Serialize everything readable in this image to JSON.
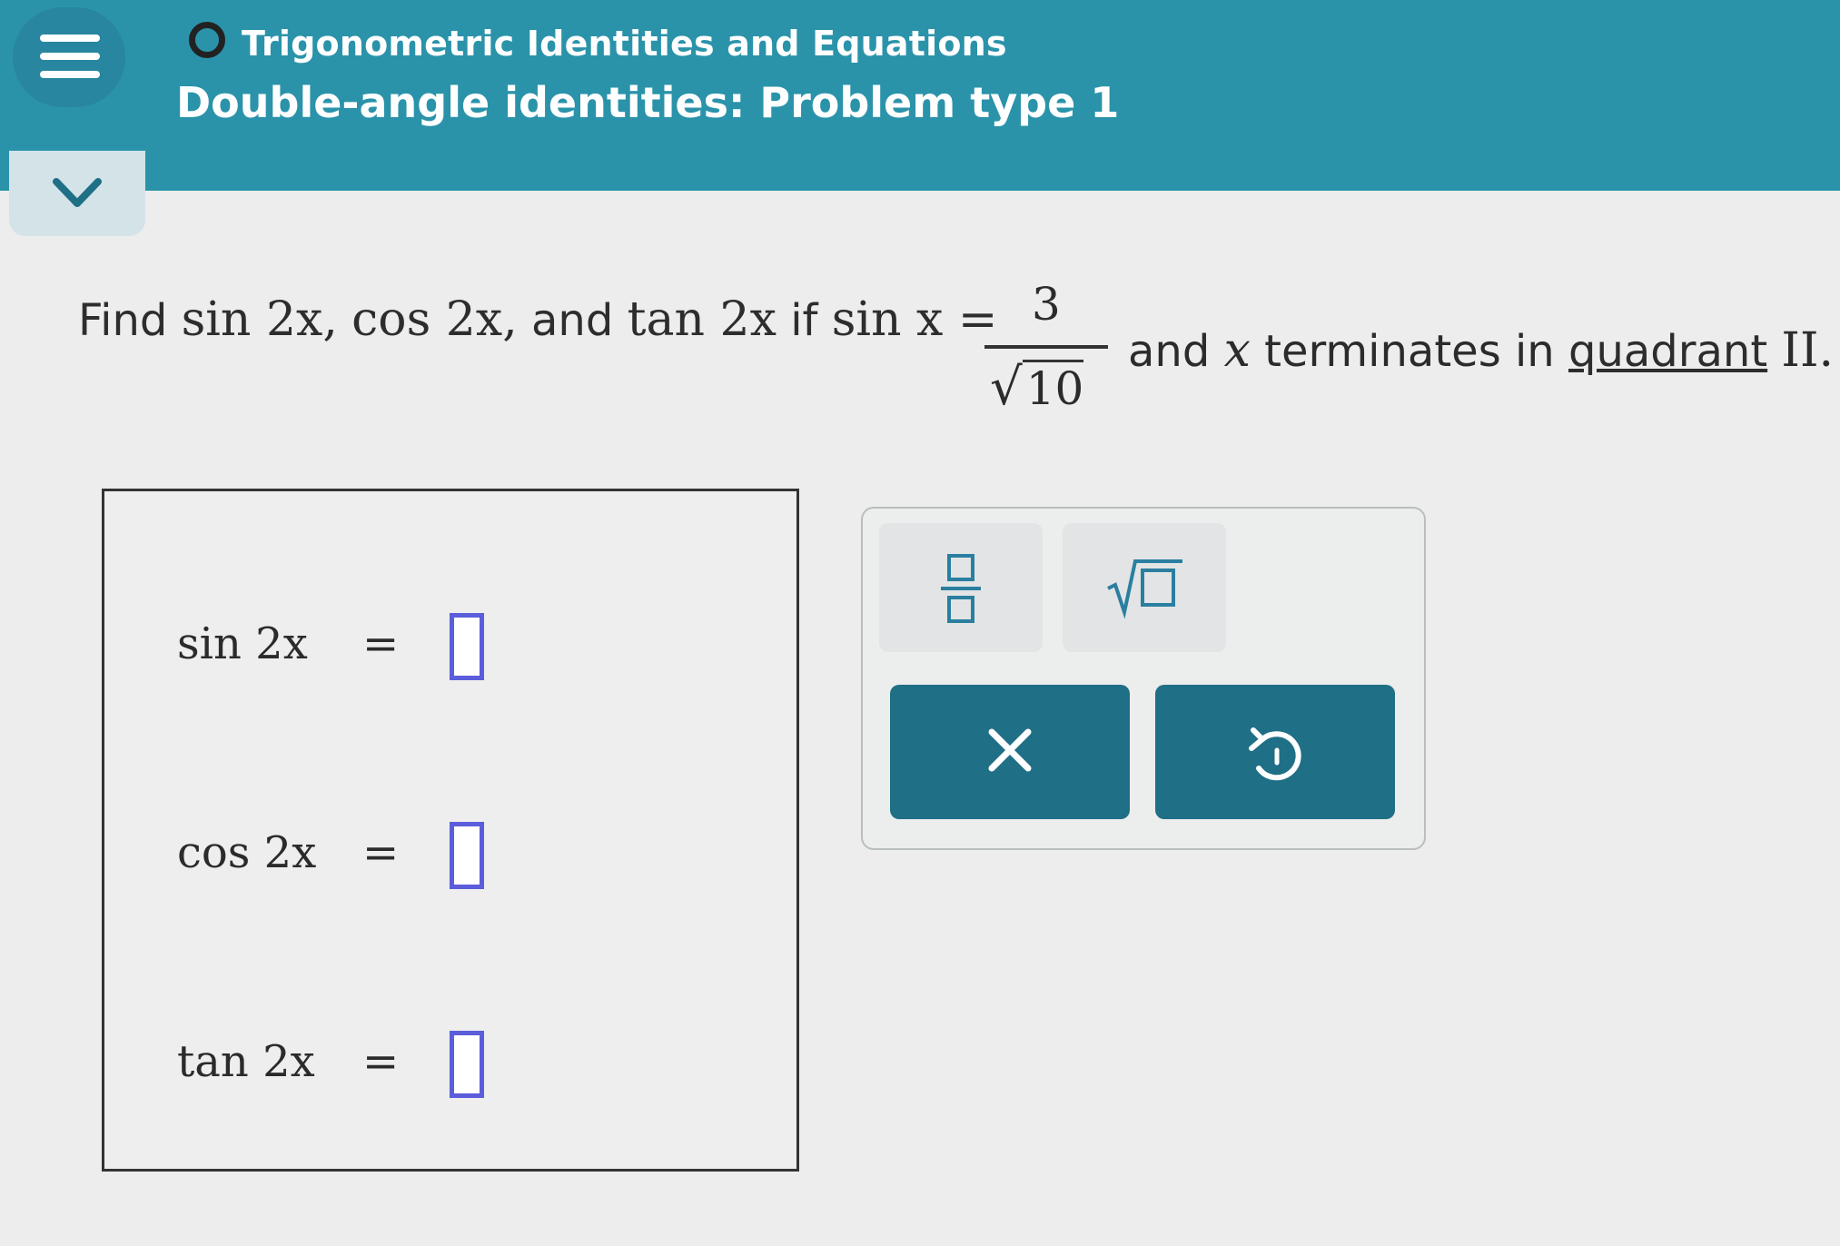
{
  "header": {
    "topic": "Trigonometric Identities and Equations",
    "title": "Double-angle identities: Problem type 1"
  },
  "question": {
    "find_word": "Find",
    "f1": "sin 2x,",
    "f2": "cos 2x,",
    "and_word": "and",
    "f3": "tan 2x",
    "if_word": "if",
    "given": "sin x =",
    "numerator": "3",
    "denominator": "10",
    "tail_before": "and",
    "tail_var": "x",
    "tail_mid": "terminates in",
    "link": "quadrant",
    "tail_end": "II."
  },
  "answers": [
    {
      "label": "sin 2x",
      "eq": "=",
      "value": ""
    },
    {
      "label": "cos 2x",
      "eq": "=",
      "value": ""
    },
    {
      "label": "tan 2x",
      "eq": "=",
      "value": ""
    }
  ],
  "keypad": {
    "keys": [
      "fraction-template",
      "sqrt-template"
    ],
    "clear_symbol": "×",
    "undo_symbol": "↺"
  },
  "colors": {
    "header_bg": "#2a93aa",
    "action_bg": "#1f6f86",
    "input_border": "#5b5ddb"
  }
}
